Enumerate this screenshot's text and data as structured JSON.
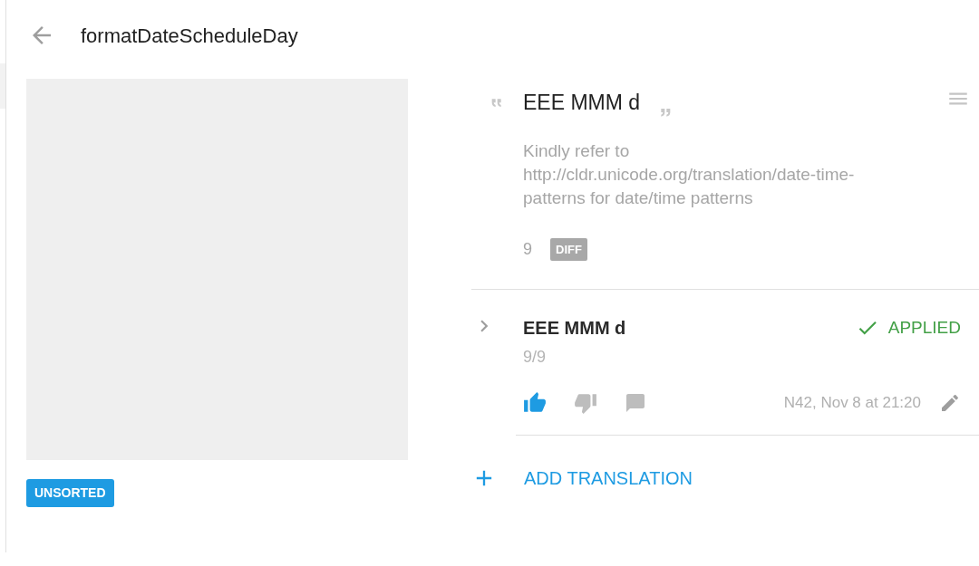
{
  "header": {
    "title": "formatDateScheduleDay"
  },
  "tag": "UNSORTED",
  "source": {
    "text": "EEE MMM d",
    "comment": "Kindly refer to http://cldr.unicode.org/translation/date-time-patterns for date/time patterns",
    "count": "9",
    "diff_label": "DIFF"
  },
  "translations": [
    {
      "text": "EEE MMM d",
      "score": "9/9",
      "status": "APPLIED",
      "applied": true,
      "upvoted": true,
      "downvoted": false,
      "meta": "N42, Nov 8 at 21:20",
      "expanded": false
    }
  ],
  "add_translation": {
    "label": "ADD TRANSLATION"
  }
}
